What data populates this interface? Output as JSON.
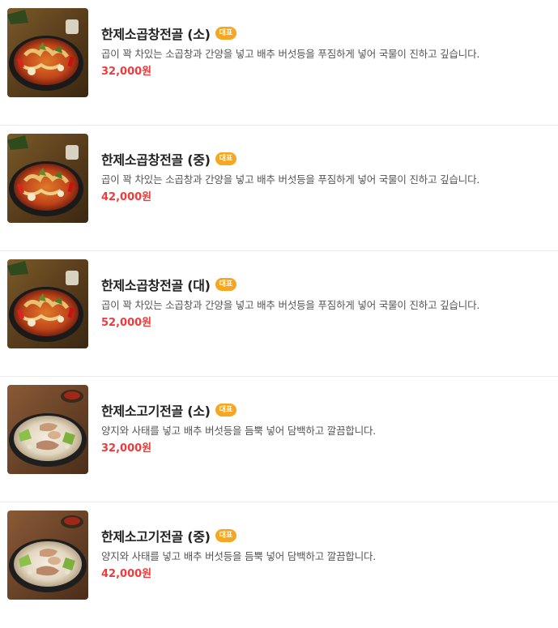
{
  "colors": {
    "badge": "#f5a623",
    "price": "#ef3b3b",
    "title": "#222222",
    "description": "#555555",
    "divider": "#ececec"
  },
  "menu": {
    "items": [
      {
        "image": "gopchang-jeongol-photo",
        "name": "한제소곱창전골 (소)",
        "badge": "대표",
        "description": "곱이 꽉 차있는 소곱창과 간양을 넣고 배추 버섯등을 푸짐하게 넣어 국물이 진하고 깊습니다.",
        "price": "32,000원"
      },
      {
        "image": "gopchang-jeongol-photo",
        "name": "한제소곱창전골 (중)",
        "badge": "대표",
        "description": "곱이 꽉 차있는 소곱창과 간양을 넣고 배추 버섯등을 푸짐하게 넣어 국물이 진하고 깊습니다.",
        "price": "42,000원"
      },
      {
        "image": "gopchang-jeongol-photo",
        "name": "한제소곱창전골 (대)",
        "badge": "대표",
        "description": "곱이 꽉 차있는 소곱창과 간양을 넣고 배추 버섯등을 푸짐하게 넣어 국물이 진하고 깊습니다.",
        "price": "52,000원"
      },
      {
        "image": "sogogi-jeongol-photo",
        "name": "한제소고기전골 (소)",
        "badge": "대표",
        "description": "양지와 사태를 넣고 배추 버섯등을 듬뿍 넣어 담백하고 깔끔합니다.",
        "price": "32,000원"
      },
      {
        "image": "sogogi-jeongol-photo",
        "name": "한제소고기전골 (중)",
        "badge": "대표",
        "description": "양지와 사태를 넣고 배추 버섯등을 듬뿍 넣어 담백하고 깔끔합니다.",
        "price": "42,000원"
      }
    ]
  }
}
